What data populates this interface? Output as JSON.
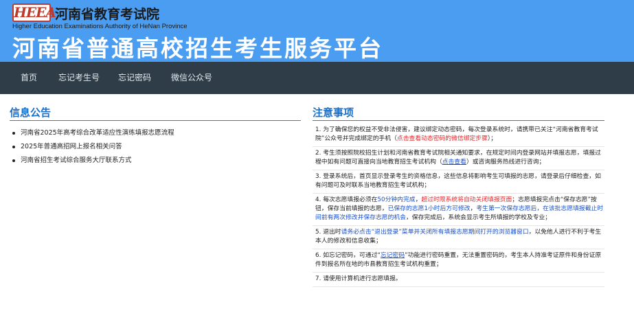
{
  "header": {
    "logo_text": "HEEA",
    "org_cn": "河南省教育考试院",
    "org_en": "Higher Education Examinations Authority of HeNan Province",
    "platform_title": "河南省普通高校招生考生服务平台",
    "bg_color": "#4a9df0"
  },
  "nav": {
    "items": [
      {
        "label": "首页"
      },
      {
        "label": "忘记考生号"
      },
      {
        "label": "忘记密码"
      },
      {
        "label": "微信公众号"
      }
    ],
    "bg_color": "#2e3d48"
  },
  "notices": {
    "title": "信息公告",
    "items": [
      "河南省2025年高考综合改革适应性演练填报志愿流程",
      "2025年普通高招网上报名相关问答",
      "河南省招生考试综合服务大厅联系方式"
    ]
  },
  "rules": {
    "title": "注意事项",
    "r1": {
      "num": "1.",
      "a": "为了确保您的权益不受非法侵害，建议绑定动态密码，每次登录系统时，请携带已关注“河南省教育考试院”公众号并完成绑定的手机（",
      "b": "点击查看动态密码的微信绑定步骤",
      "c": "）；"
    },
    "r2": {
      "num": "2.",
      "a": "考生须按照院校招生计划和河南省教育考试院相关通知要求，在规定时间内登录网站并填报志愿，填报过程中如有问题可直接向当地教育招生考试机构（",
      "b": "点击查看",
      "c": "）或咨询服务热线进行咨询；"
    },
    "r3": {
      "num": "3.",
      "a": "登录系统后，首页显示登录考生的资格信息，这些信息将影响考生可填报的志愿，请登录后仔细检查，如有问题可及时联系当地教育招生考试机构；"
    },
    "r4": {
      "num": "4.",
      "a": "每次志愿填报必须在",
      "b": "50分钟内完成",
      "c": "，",
      "d": "超过时限系统将自动关闭填报页面",
      "e": "；志愿填报完点击“保存志愿”按钮，保存当前填报的志愿，",
      "f": "已保存的志愿1小时后方可修改",
      "g": "，",
      "h": "考生第一次保存志愿后，在该批志愿填报截止时间前有两次修改并保存志愿的机会",
      "i": "，保存完成后，系统会显示考生所填报的学校及专业；"
    },
    "r5": {
      "num": "5.",
      "a": "退出时",
      "b": "请务必点击“退出登录”菜单并关闭所有填报志愿期间打开的浏览器窗口",
      "c": "，以免他人进行不利于考生本人的修改和信息收集；"
    },
    "r6": {
      "num": "6.",
      "a": "如忘记密码，可通过“",
      "b": "忘记密码",
      "c": "”功能进行密码重置，无法重置密码的，考生本人持准考证原件和身份证原件到报名所在地的市县教育招生考试机构重置；"
    },
    "r7": {
      "num": "7.",
      "a": "请使用计算机进行志愿填报。"
    }
  }
}
